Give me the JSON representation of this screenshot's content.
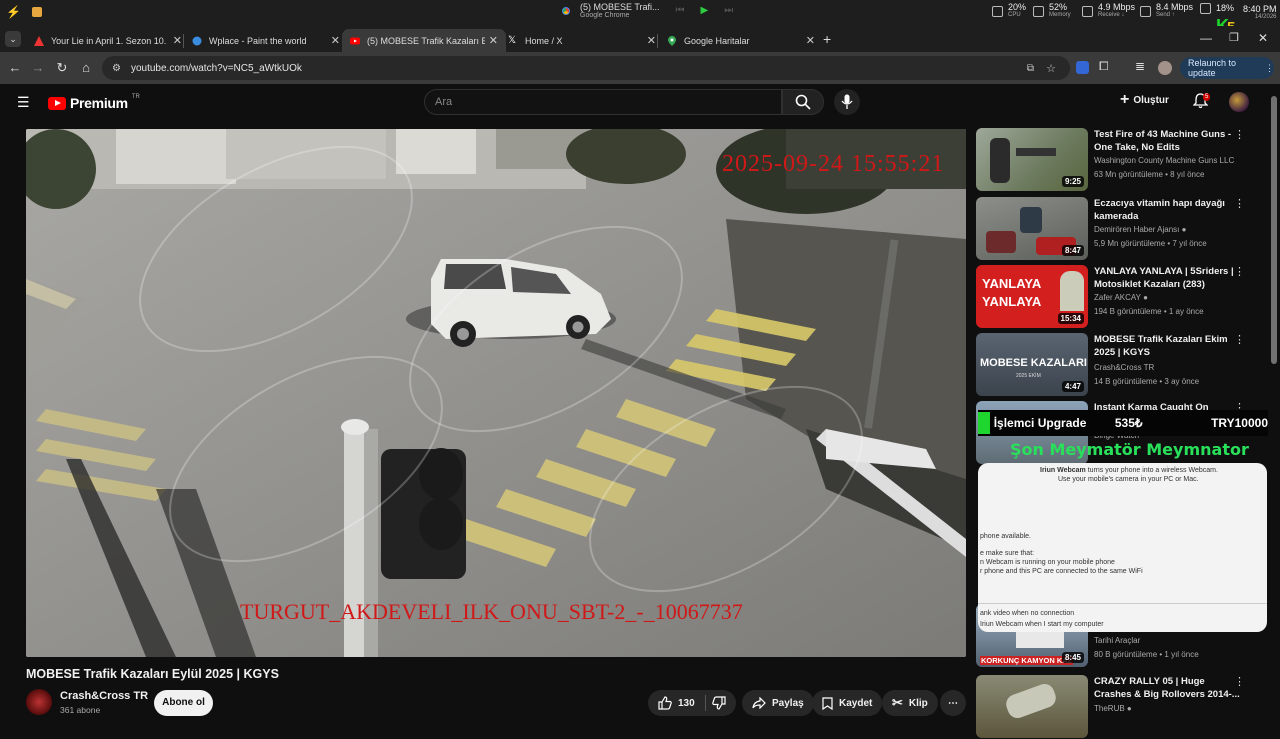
{
  "system_bar": {
    "now_playing_title": "(5) MOBESE Trafi...",
    "now_playing_app": "Google Chrome",
    "cpu": {
      "value": "20%",
      "label": "CPU"
    },
    "memory": {
      "value": "52%",
      "label": "Memory"
    },
    "receive": {
      "value": "4.9 Mbps",
      "label": "Receive ↓"
    },
    "send": {
      "value": "8.4 Mbps",
      "label": "Send ↑"
    },
    "battery": {
      "value": "18%"
    },
    "time": "8:40 PM",
    "date": "14/2026"
  },
  "tabs": [
    {
      "title": "Your Lie in April 1. Sezon 10. Bö",
      "icon": "warning-icon",
      "active": false
    },
    {
      "title": "Wplace - Paint the world",
      "icon": "globe-icon",
      "active": false
    },
    {
      "title": "(5) MOBESE Trafik Kazaları Eylül",
      "icon": "youtube-icon",
      "active": true
    },
    {
      "title": "Home / X",
      "icon": "x-icon",
      "active": false
    },
    {
      "title": "Google Haritalar",
      "icon": "maps-icon",
      "active": false
    }
  ],
  "address_bar": {
    "url": "youtube.com/watch?v=NC5_aWtkUOk",
    "relaunch_label": "Relaunch to update"
  },
  "youtube_header": {
    "brand": "Premium",
    "country": "TR",
    "search_placeholder": "Ara",
    "create_label": "Oluştur",
    "notification_count": "5"
  },
  "video": {
    "timestamp": "2025-09-24  15:55:21",
    "camera_label": "TURGUT_AKDEVELI_ILK_ONU_SBT-2_-_10067737"
  },
  "video_info": {
    "title": "MOBESE Trafik Kazaları Eylül 2025 | KGYS",
    "channel": "Crash&Cross TR",
    "subscribers": "361 abone",
    "subscribe_label": "Abone ol",
    "likes": "130",
    "share_label": "Paylaş",
    "save_label": "Kaydet",
    "clip_label": "Klip"
  },
  "recommendations": [
    {
      "title": "Test Fire of 43 Machine Guns - One Take, No Edits",
      "channel": "Washington County Machine Guns LLC",
      "meta": "63 Mn görüntüleme • 8 yıl önce",
      "duration": "9:25"
    },
    {
      "title": "Eczacıya vitamin hapı dayağı kamerada",
      "channel": "Demirören Haber Ajansı",
      "meta": "5,9 Mn görüntüleme • 7 yıl önce",
      "duration": "8:47",
      "verified": true
    },
    {
      "title": "YANLAYA YANLAYA | 5Sriders | Motosiklet Kazaları (283)",
      "channel": "Zafer AKCAY",
      "meta": "194 B görüntüleme • 1 ay önce",
      "duration": "15:34",
      "verified": true,
      "thumb_text": "YANLAYA YANLAYA"
    },
    {
      "title": "MOBESE Trafik Kazaları Ekim 2025 | KGYS",
      "channel": "Crash&Cross TR",
      "meta": "14 B görüntüleme • 3 ay önce",
      "duration": "4:47",
      "thumb_text": "MOBESE KAZALARI",
      "thumb_sub": "2025 EKİM"
    },
    {
      "title": "Instant Karma Caught On",
      "channel": "Binge Watch",
      "meta": "",
      "duration": ""
    },
    {
      "title": "",
      "channel": "Tarihi Araçlar",
      "meta": "80 B görüntüleme • 1 yıl önce",
      "duration": "8:45",
      "thumb_text": "KORKUNÇ KAMYON KAZ"
    },
    {
      "title": "CRAZY RALLY 05 | Huge Crashes & Big Rollovers 2014-...",
      "channel": "TheRUB",
      "meta": "",
      "duration": "",
      "verified": true
    }
  ],
  "overlays": {
    "cpu_upgrade": {
      "label": "İşlemci Upgrade",
      "price": "535₺",
      "currency_value": "TRY10000"
    },
    "meym_text": "Şon Meymatör Meymnator",
    "iriun": {
      "line1_brand": "Iriun Webcam",
      "line1_rest": " turns your phone into a wireless Webcam.",
      "line2": "Use your mobile's camera in your PC or Mac.",
      "line3": "phone available.",
      "line4": "e make sure that:",
      "line5": "n Webcam is running on your mobile phone",
      "line6": "r phone and this PC are connected to the same WiFi",
      "line7": "ank video when no connection",
      "line8": "Iriun Webcam when I start my computer"
    },
    "logo_letter": "K",
    "logo_number": "5"
  },
  "colors": {
    "yt_red": "#ff0000",
    "cam_red": "#d01818",
    "overlay_green": "#29e05a",
    "background": "#0f0f0f"
  }
}
